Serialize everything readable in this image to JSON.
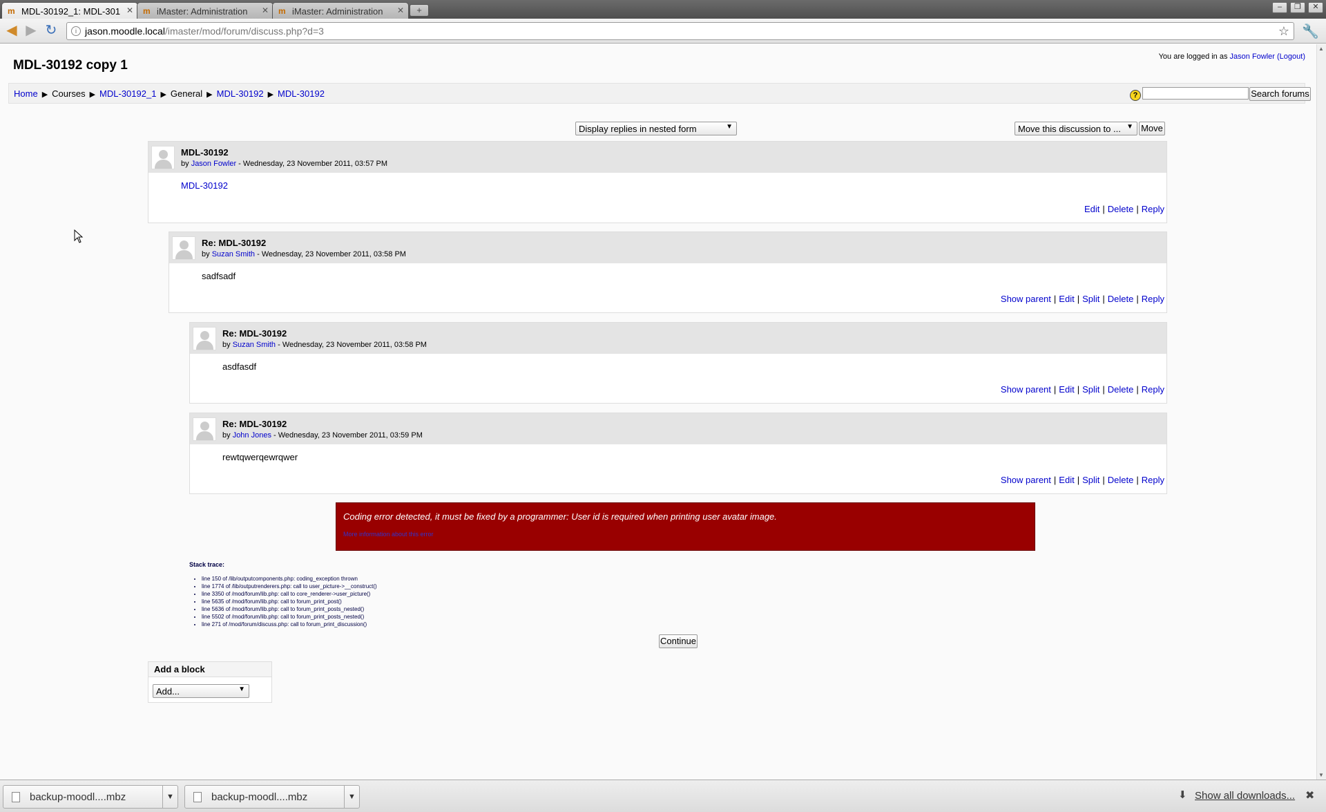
{
  "browser": {
    "tabs": [
      {
        "label": "MDL-30192_1: MDL-301"
      },
      {
        "label": "iMaster: Administration"
      },
      {
        "label": "iMaster: Administration"
      }
    ],
    "url_host": "jason.moodle.local",
    "url_path": "/imaster/mod/forum/discuss.php?d=3"
  },
  "page": {
    "title": "MDL-30192 copy 1",
    "login_prefix": "You are logged in as ",
    "login_user": "Jason Fowler",
    "logout_label": "(Logout)",
    "breadcrumb": [
      "Home",
      "Courses",
      "MDL-30192_1",
      "General",
      "MDL-30192",
      "MDL-30192"
    ],
    "search_button": "Search forums",
    "display_mode": "Display replies in nested form",
    "move_select": "Move this discussion to ...",
    "move_button": "Move"
  },
  "posts": [
    {
      "subject": "MDL-30192",
      "author": "Jason Fowler",
      "date": " - Wednesday, 23 November 2011, 03:57 PM",
      "message": "MDL-30192",
      "commands": [
        "Edit",
        "Delete",
        "Reply"
      ]
    },
    {
      "subject": "Re: MDL-30192",
      "author": "Suzan Smith",
      "date": " - Wednesday, 23 November 2011, 03:58 PM",
      "message": "sadfsadf",
      "commands": [
        "Show parent",
        "Edit",
        "Split",
        "Delete",
        "Reply"
      ]
    },
    {
      "subject": "Re: MDL-30192",
      "author": "Suzan Smith",
      "date": " - Wednesday, 23 November 2011, 03:58 PM",
      "message": "asdfasdf",
      "commands": [
        "Show parent",
        "Edit",
        "Split",
        "Delete",
        "Reply"
      ]
    },
    {
      "subject": "Re: MDL-30192",
      "author": "John Jones",
      "date": " - Wednesday, 23 November 2011, 03:59 PM",
      "message": "rewtqwerqewrqwer",
      "commands": [
        "Show parent",
        "Edit",
        "Split",
        "Delete",
        "Reply"
      ]
    }
  ],
  "byline_prefix": "by ",
  "error": {
    "message": "Coding error detected, it must be fixed by a programmer: User id is required when printing user avatar image.",
    "more_info": "More information about this error",
    "stack_title": "Stack trace:",
    "stack": [
      "line 150 of /lib/outputcomponents.php: coding_exception thrown",
      "line 1774 of /lib/outputrenderers.php: call to user_picture->__construct()",
      "line 3350 of /mod/forum/lib.php: call to core_renderer->user_picture()",
      "line 5635 of /mod/forum/lib.php: call to forum_print_post()",
      "line 5636 of /mod/forum/lib.php: call to forum_print_posts_nested()",
      "line 5502 of /mod/forum/lib.php: call to forum_print_posts_nested()",
      "line 271 of /mod/forum/discuss.php: call to forum_print_discussion()"
    ],
    "continue_label": "Continue"
  },
  "block": {
    "title": "Add a block",
    "select_label": "Add..."
  },
  "downloads": {
    "items": [
      "backup-moodl....mbz",
      "backup-moodl....mbz"
    ],
    "show_all": "Show all downloads..."
  }
}
